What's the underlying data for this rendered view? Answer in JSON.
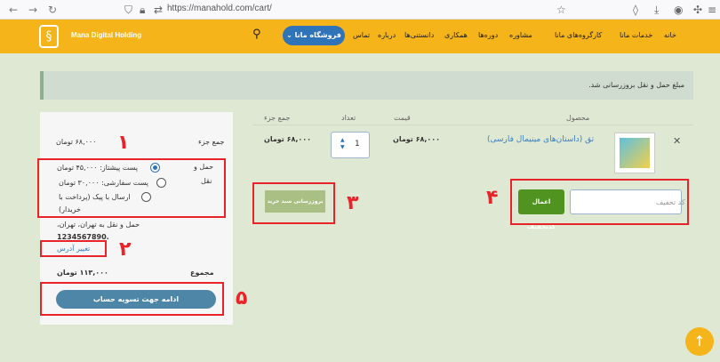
{
  "browser": {
    "url": "https://manahold.com/cart/"
  },
  "header": {
    "brand": "Mana Digital Holding",
    "store_button": "فروشگاه مانا",
    "nav": [
      "خانه",
      "خدمات مانا",
      "کارگروه‌های مانا",
      "مشاوره",
      "دوره‌ها",
      "همکاری",
      "دانستنی‌ها",
      "درباره",
      "تماس"
    ]
  },
  "notice": "مبلغ حمل و نقل بروزرسانی شد.",
  "table": {
    "headers": {
      "product": "محصول",
      "price": "قیمت",
      "quantity": "تعداد",
      "subtotal": "جمع جزء"
    },
    "item": {
      "name": "تق (داستان‌های مینیمال فارسی)",
      "price": "۶۸,۰۰۰ تومان",
      "quantity": "1",
      "subtotal": "۶۸,۰۰۰ تومان"
    },
    "update_button": "بروزرسانی سبد خرید",
    "coupon_placeholder": "کد تخفیف",
    "coupon_button": "اعمال کدتخفیف"
  },
  "totals": {
    "subtotal_label": "جمع جزء",
    "subtotal_value": "۶۸,۰۰۰ تومان",
    "shipping_label_1": "حمل و",
    "shipping_label_2": "نقل",
    "options": [
      {
        "label": "پست پیشتاز: ۴۵,۰۰۰ تومان",
        "selected": true
      },
      {
        "label": "پست سفارشی: ۳۰,۰۰۰ تومان",
        "selected": false
      },
      {
        "label": "ارسال با پیک (پرداخت با",
        "selected": false
      }
    ],
    "option3_line2": "خریدار)",
    "ship_to_line1": "حمل و نقل به تهران، تهران،",
    "ship_to_line2": "1234567890.",
    "change_address": "تغییر آدرس",
    "total_label": "مجموع",
    "total_value": "۱۱۳,۰۰۰ تومان",
    "checkout_button": "ادامه جهت تسویه حساب"
  },
  "annotations": [
    "۱",
    "۲",
    "۳",
    "۴",
    "۵"
  ]
}
